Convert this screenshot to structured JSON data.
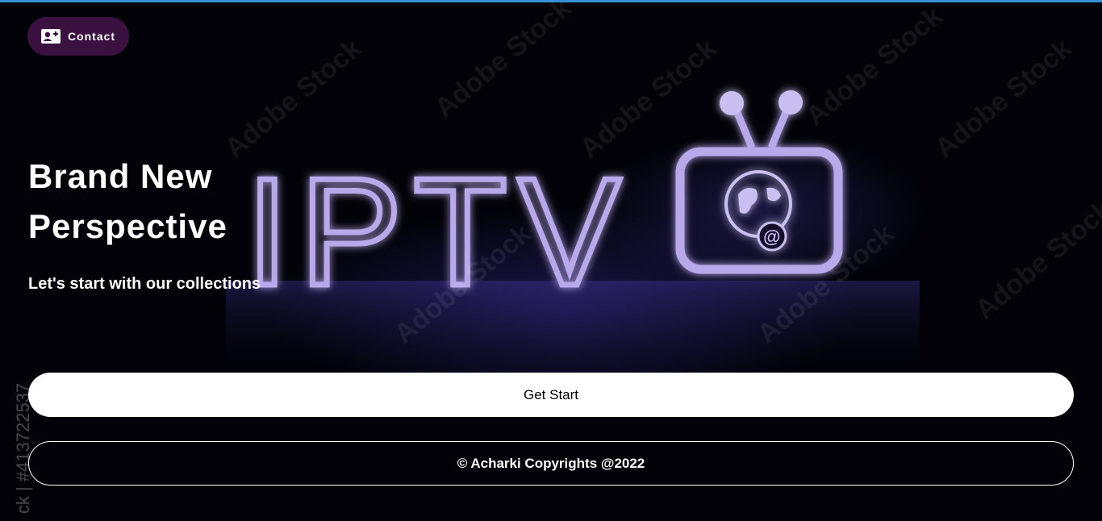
{
  "header": {
    "contact_label": "Contact",
    "contact_icon": "contact-card-icon"
  },
  "hero": {
    "title": "Brand New Perspective",
    "subtitle": "Let's start with our collections",
    "background_word": "IPTV",
    "background_icon": "tv-globe-icon",
    "watermark_text": "Adobe Stock",
    "side_id_text": "ck | #413722537"
  },
  "actions": {
    "start_label": "Get Start"
  },
  "footer": {
    "copyright": "© Acharki Copyrights @2022"
  },
  "colors": {
    "accent_bar": "#3a8fd6",
    "contact_bg": "#3a1140",
    "neon": "#b7a9ea",
    "background": "#020208"
  }
}
